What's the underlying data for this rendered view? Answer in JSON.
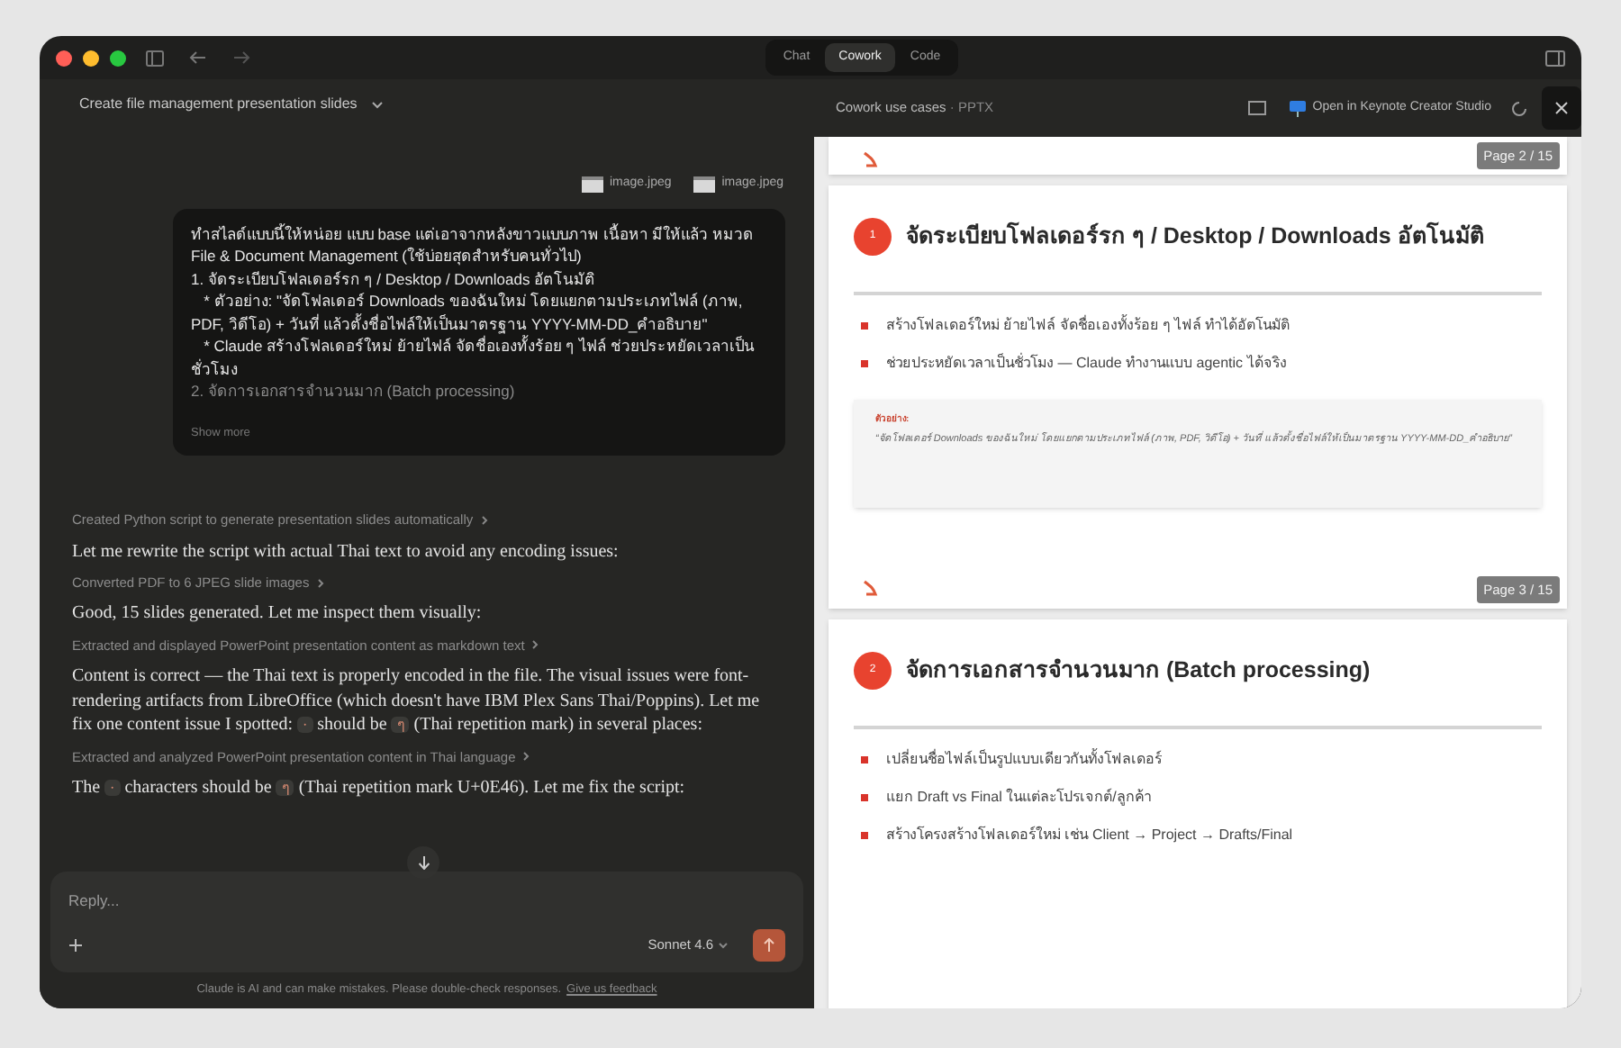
{
  "window": {
    "mode_tabs": [
      {
        "label": "Chat",
        "selected": false
      },
      {
        "label": "Cowork",
        "selected": true
      },
      {
        "label": "Code",
        "selected": false
      }
    ]
  },
  "conversation": {
    "title": "Create file management presentation slides",
    "attachments": [
      {
        "name": "image.jpeg"
      },
      {
        "name": "image.jpeg"
      }
    ],
    "user_message": {
      "lines": [
        "ทำสไลด์แบบนี้ให้หน่อย แบบ base แต่เอาจากหลังขาวแบบภาพ เนื้อหา มีให้แล้ว หมวด File & Document Management (ใช้บ่อยสุดสำหรับคนทั่วไป)",
        "1. จัดระเบียบโฟลเดอร์รก ๆ / Desktop / Downloads อัตโนมัติ",
        "   * ตัวอย่าง: \"จัดโฟลเดอร์ Downloads ของฉันใหม่ โดยแยกตามประเภทไฟล์ (ภาพ, PDF, วิดีโอ) + วันที่ แล้วตั้งชื่อไฟล์ให้เป็นมาตรฐาน YYYY-MM-DD_คำอธิบาย\"",
        "   * Claude สร้างโฟลเดอร์ใหม่ ย้ายไฟล์ จัดชื่อเองทั้งร้อย ๆ ไฟล์ ช่วยประหยัดเวลาเป็นชั่วโมง",
        "2. จัดการเอกสารจำนวนมาก (Batch processing)"
      ],
      "show_more": "Show more"
    },
    "steps": [
      {
        "kind": "tool",
        "text": "Created Python script to generate presentation slides automatically"
      },
      {
        "kind": "prose",
        "parts": [
          {
            "kind": "text",
            "text": "Let me rewrite the script with actual Thai text to avoid any encoding issues:"
          }
        ]
      },
      {
        "kind": "tool",
        "text": "Converted PDF to 6 JPEG slide images"
      },
      {
        "kind": "prose",
        "parts": [
          {
            "kind": "text",
            "text": "Good, 15 slides generated. Let me inspect them visually:"
          }
        ]
      },
      {
        "kind": "tool",
        "text": "Extracted and displayed PowerPoint presentation content as markdown text"
      },
      {
        "kind": "prose",
        "parts": [
          {
            "kind": "text",
            "text": "Content is correct — the Thai text is properly encoded in the file. The visual issues were font-rendering artifacts from LibreOffice (which doesn't have IBM Plex Sans Thai/Poppins). Let me fix one content issue I spotted: "
          },
          {
            "kind": "code",
            "text": "·"
          },
          {
            "kind": "text",
            "text": " should be "
          },
          {
            "kind": "code",
            "text": "ๆ"
          },
          {
            "kind": "text",
            "text": " (Thai repetition mark) in several places:"
          }
        ]
      },
      {
        "kind": "tool",
        "text": "Extracted and analyzed PowerPoint presentation content in Thai language"
      },
      {
        "kind": "prose",
        "parts": [
          {
            "kind": "text",
            "text": "The "
          },
          {
            "kind": "code",
            "text": "·"
          },
          {
            "kind": "text",
            "text": " characters should be "
          },
          {
            "kind": "code",
            "text": "ๆ"
          },
          {
            "kind": "text",
            "text": " (Thai repetition mark U+0E46). Let me fix the script:"
          }
        ]
      }
    ],
    "composer": {
      "placeholder": "Reply...",
      "model": "Sonnet 4.6"
    },
    "disclaimer": "Claude is AI and can make mistakes. Please double-check responses.",
    "feedback_link": "Give us feedback"
  },
  "preview": {
    "title": "Cowork use cases",
    "separator": "·",
    "file_type": "PPTX",
    "open_button": "Open in Keynote Creator Studio",
    "slides": [
      {
        "page_label": "Page 2 / 15"
      },
      {
        "number": "1",
        "title": "จัดระเบียบโฟลเดอร์รก ๆ / Desktop / Downloads อัตโนมัติ",
        "bullets": [
          "สร้างโฟลเดอร์ใหม่ ย้ายไฟล์ จัดชื่อเองทั้งร้อย ๆ ไฟล์ ทำได้อัตโนมัติ",
          "ช่วยประหยัดเวลาเป็นชั่วโมง — Claude ทำงานแบบ agentic ได้จริง"
        ],
        "example": {
          "label": "ตัวอย่าง:",
          "text": "“จัดโฟลเดอร์ Downloads ของฉันใหม่ โดยแยกตามประเภทไฟล์ (ภาพ, PDF, วิดีโอ) + วันที่ แล้วตั้งชื่อไฟล์ให้เป็นมาตรฐาน YYYY-MM-DD_คำอธิบาย”"
        },
        "page_label": "Page 3 / 15"
      },
      {
        "number": "2",
        "title": "จัดการเอกสารจำนวนมาก (Batch processing)",
        "bullets": [
          "เปลี่ยนชื่อไฟล์เป็นรูปแบบเดียวกันทั้งโฟลเดอร์",
          "แยก Draft vs Final ในแต่ละโปรเจกต์/ลูกค้า",
          "สร้างโครงสร้างโฟลเดอร์ใหม่ เช่น Client → Project → Drafts/Final"
        ]
      }
    ]
  }
}
